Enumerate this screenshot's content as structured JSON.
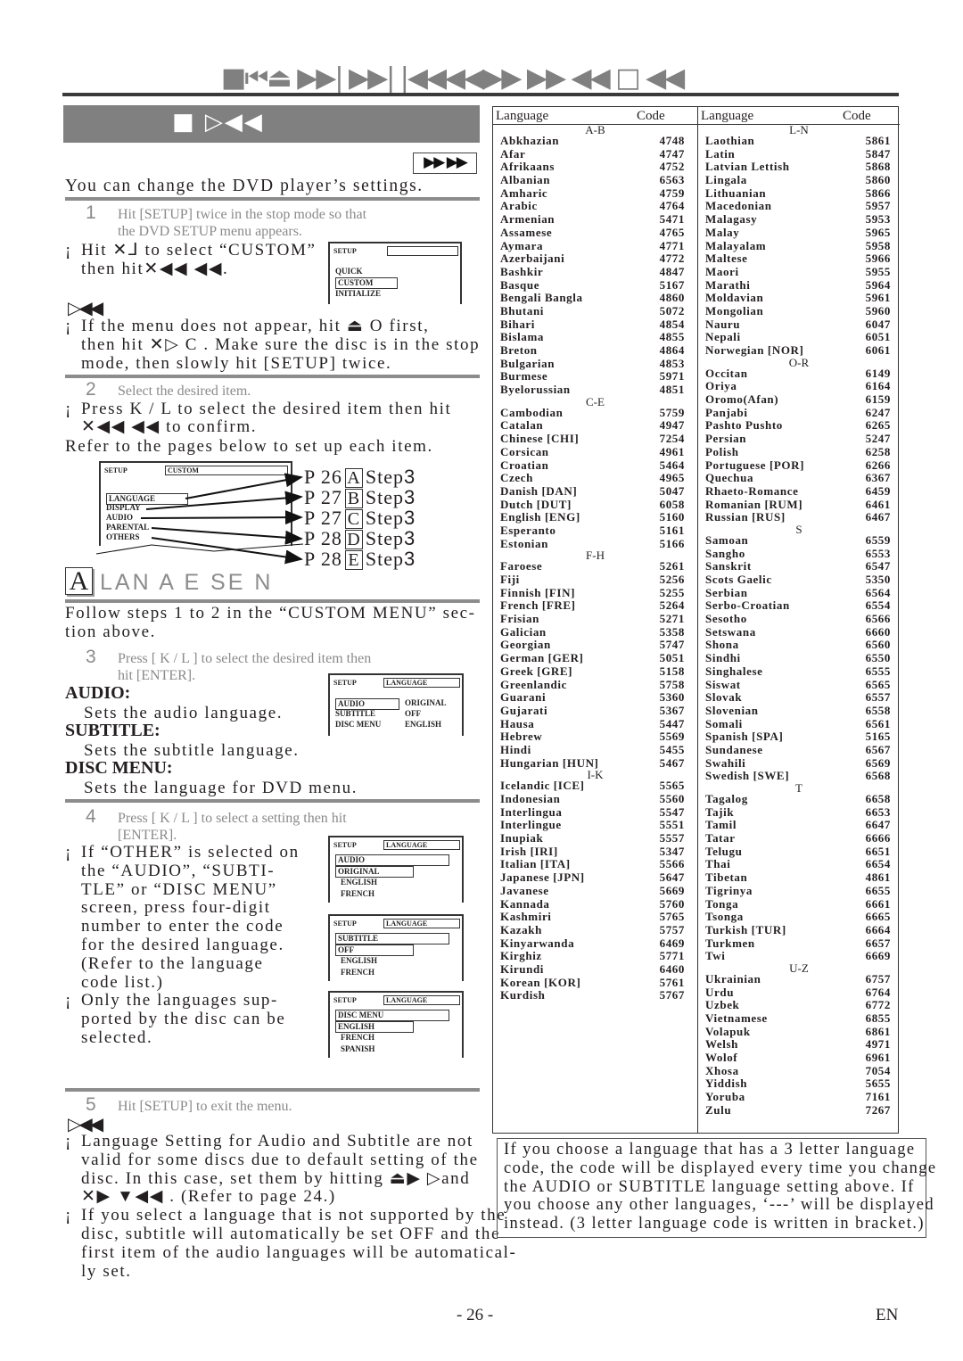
{
  "header": {
    "title_glyphs": "■⏮⏏ ▶▶| ▶▶| |◀◀◀◀▶▶ ▶▶ ◀◀ □ ◀◀",
    "section_banner_glyphs": "■  ▷◀◀",
    "badge_glyphs": "▶▶ ▶▶"
  },
  "intro": "You can change the DVD player’s settings.",
  "steps": {
    "s1": {
      "num": "1",
      "line1": "Hit [SETUP] twice in the stop mode so that",
      "line2": "the DVD SETUP menu appears."
    },
    "s1_bullet": {
      "line1": "Hit ✕⅃   to select “CUSTOM”",
      "line2": "then hit✕◀◀ ◀◀."
    },
    "note1_icon": "▷◀◀",
    "s1_note": {
      "line1": "If the menu does not appear, hit ⏏ O   first,",
      "line2": "then hit ✕▷   C . Make sure the disc is in the stop",
      "line3": "mode, then slowly hit [SETUP] twice."
    },
    "s2": {
      "num": "2",
      "text": "Select the desired item."
    },
    "s2_bullet": {
      "line1": "Press K / L   to select the desired item then hit",
      "line2": "✕◀◀ ◀◀ to confirm."
    },
    "s2_refer": "Refer to the pages below to set up each item.",
    "s3": {
      "num": "3",
      "line1": "Press [  K / L ] to select the desired item then",
      "line2": "hit [ENTER]."
    },
    "s4": {
      "num": "4",
      "line1": "Press [  K / L ] to select a setting then hit",
      "line2": "[ENTER]."
    },
    "s5": {
      "num": "5",
      "text": "Hit [SETUP] to exit the menu."
    }
  },
  "setup_osd_main": {
    "header": "SETUP",
    "items": [
      "QUICK",
      "CUSTOM",
      "INITIALIZE"
    ],
    "selected": "CUSTOM"
  },
  "custom_osd": {
    "header": "SETUP",
    "header_value": "CUSTOM",
    "items": [
      "LANGUAGE",
      "DISPLAY",
      "AUDIO",
      "PARENTAL",
      "OTHERS"
    ]
  },
  "page_refs": [
    {
      "page": "P 26",
      "letter": "A",
      "step": "Step",
      "step_num": "3"
    },
    {
      "page": "P 27",
      "letter": "B",
      "step": "Step",
      "step_num": "3"
    },
    {
      "page": "P 27",
      "letter": "C",
      "step": "Step",
      "step_num": "3"
    },
    {
      "page": "P 28",
      "letter": "D",
      "step": "Step",
      "step_num": "3"
    },
    {
      "page": "P 28",
      "letter": "E",
      "step": "Step",
      "step_num": "3"
    }
  ],
  "language_section": {
    "letter": "A",
    "title": "LAN  A  E SE N",
    "follow_line1": "Follow steps 1 to 2 in the “CUSTOM MENU” sec-",
    "follow_line2": "tion above.",
    "audio_label": "AUDIO:",
    "audio_desc": "Sets the audio language.",
    "subtitle_label": "SUBTITLE:",
    "subtitle_desc": "Sets the subtitle language.",
    "discmenu_label": "DISC MENU:",
    "discmenu_desc": "Sets the language for DVD menu."
  },
  "language_osd": {
    "header": "SETUP",
    "header_value": "LANGUAGE",
    "rows": [
      {
        "name": "AUDIO",
        "value": "ORIGINAL"
      },
      {
        "name": "SUBTITLE",
        "value": "OFF"
      },
      {
        "name": "DISC MENU",
        "value": "ENGLISH"
      }
    ]
  },
  "sub_osds": [
    {
      "header": "SETUP",
      "header_value": "LANGUAGE",
      "title": "AUDIO",
      "options": [
        "ORIGINAL",
        "ENGLISH",
        "FRENCH"
      ]
    },
    {
      "header": "SETUP",
      "header_value": "LANGUAGE",
      "title": "SUBTITLE",
      "options": [
        "OFF",
        "ENGLISH",
        "FRENCH"
      ]
    },
    {
      "header": "SETUP",
      "header_value": "LANGUAGE",
      "title": "DISC MENU",
      "options": [
        "ENGLISH",
        "FRENCH",
        "SPANISH"
      ]
    }
  ],
  "s4_bullets": {
    "other": [
      "If “OTHER” is selected on",
      "the “AUDIO”, “SUBTI-",
      "TLE” or “DISC MENU”",
      "screen, press four-digit",
      "number to enter the code",
      "for the desired language.",
      "(Refer to the language",
      "code list.)"
    ],
    "only": [
      "Only the languages sup-",
      "ported by the disc can be",
      "selected."
    ]
  },
  "final_notes": {
    "icon": "▷◀◀",
    "n1": [
      "Language Setting for Audio and Subtitle are not",
      "valid for some discs due to default setting of the",
      "disc. In this case, set them by hitting ⏏▶ ▷and",
      "✕▶  ▼◀◀  . (Refer to page 24.)"
    ],
    "n2": [
      "If you select a language that is not supported by the",
      "disc, subtitle will automatically be set OFF and the",
      "first item of the audio languages will be automatical-",
      "ly set."
    ]
  },
  "language_table": {
    "headers": {
      "language": "Language",
      "code": "Code"
    },
    "columns": [
      [
        {
          "group": "A-B"
        },
        {
          "name": "Abkhazian",
          "code": "4748"
        },
        {
          "name": "Afar",
          "code": "4747"
        },
        {
          "name": "Afrikaans",
          "code": "4752"
        },
        {
          "name": "Albanian",
          "code": "6563"
        },
        {
          "name": "Amharic",
          "code": "4759"
        },
        {
          "name": "Arabic",
          "code": "4764"
        },
        {
          "name": "Armenian",
          "code": "5471"
        },
        {
          "name": "Assamese",
          "code": "4765"
        },
        {
          "name": "Aymara",
          "code": "4771"
        },
        {
          "name": "Azerbaijani",
          "code": "4772"
        },
        {
          "name": "Bashkir",
          "code": "4847"
        },
        {
          "name": "Basque",
          "code": "5167"
        },
        {
          "name": "Bengali Bangla",
          "code": "4860"
        },
        {
          "name": "Bhutani",
          "code": "5072"
        },
        {
          "name": "Bihari",
          "code": "4854"
        },
        {
          "name": "Bislama",
          "code": "4855"
        },
        {
          "name": "Breton",
          "code": "4864"
        },
        {
          "name": "Bulgarian",
          "code": "4853"
        },
        {
          "name": "Burmese",
          "code": "5971"
        },
        {
          "name": "Byelorussian",
          "code": "4851"
        },
        {
          "group": "C-E"
        },
        {
          "name": "Cambodian",
          "code": "5759"
        },
        {
          "name": "Catalan",
          "code": "4947"
        },
        {
          "name": "Chinese [CHI]",
          "code": "7254"
        },
        {
          "name": "Corsican",
          "code": "4961"
        },
        {
          "name": "Croatian",
          "code": "5464"
        },
        {
          "name": "Czech",
          "code": "4965"
        },
        {
          "name": "Danish [DAN]",
          "code": "5047"
        },
        {
          "name": "Dutch [DUT]",
          "code": "6058"
        },
        {
          "name": "English [ENG]",
          "code": "5160"
        },
        {
          "name": "Esperanto",
          "code": "5161"
        },
        {
          "name": "Estonian",
          "code": "5166"
        },
        {
          "group": "F-H"
        },
        {
          "name": "Faroese",
          "code": "5261"
        },
        {
          "name": "Fiji",
          "code": "5256"
        },
        {
          "name": "Finnish [FIN]",
          "code": "5255"
        },
        {
          "name": "French [FRE]",
          "code": "5264"
        },
        {
          "name": "Frisian",
          "code": "5271"
        },
        {
          "name": "Galician",
          "code": "5358"
        },
        {
          "name": "Georgian",
          "code": "5747"
        },
        {
          "name": "German [GER]",
          "code": "5051"
        },
        {
          "name": "Greek [GRE]",
          "code": "5158"
        },
        {
          "name": "Greenlandic",
          "code": "5758"
        },
        {
          "name": "Guarani",
          "code": "5360"
        },
        {
          "name": "Gujarati",
          "code": "5367"
        },
        {
          "name": "Hausa",
          "code": "5447"
        },
        {
          "name": "Hebrew",
          "code": "5569"
        },
        {
          "name": "Hindi",
          "code": "5455"
        },
        {
          "name": "Hungarian [HUN]",
          "code": "5467"
        },
        {
          "group": "I-K"
        },
        {
          "name": "Icelandic [ICE]",
          "code": "5565"
        },
        {
          "name": "Indonesian",
          "code": "5560"
        },
        {
          "name": "Interlingua",
          "code": "5547"
        },
        {
          "name": "Interlingue",
          "code": "5551"
        },
        {
          "name": "Inupiak",
          "code": "5557"
        },
        {
          "name": "Irish [IRI]",
          "code": "5347"
        },
        {
          "name": "Italian [ITA]",
          "code": "5566"
        },
        {
          "name": "Japanese [JPN]",
          "code": "5647"
        },
        {
          "name": "Javanese",
          "code": "5669"
        },
        {
          "name": "Kannada",
          "code": "5760"
        },
        {
          "name": "Kashmiri",
          "code": "5765"
        },
        {
          "name": "Kazakh",
          "code": "5757"
        },
        {
          "name": "Kinyarwanda",
          "code": "6469"
        },
        {
          "name": "Kirghiz",
          "code": "5771"
        },
        {
          "name": "Kirundi",
          "code": "6460"
        },
        {
          "name": "Korean [KOR]",
          "code": "5761"
        },
        {
          "name": "Kurdish",
          "code": "5767"
        }
      ],
      [
        {
          "group": "L-N"
        },
        {
          "name": "Laothian",
          "code": "5861"
        },
        {
          "name": "Latin",
          "code": "5847"
        },
        {
          "name": "Latvian Lettish",
          "code": "5868"
        },
        {
          "name": "Lingala",
          "code": "5860"
        },
        {
          "name": "Lithuanian",
          "code": "5866"
        },
        {
          "name": "Macedonian",
          "code": "5957"
        },
        {
          "name": "Malagasy",
          "code": "5953"
        },
        {
          "name": "Malay",
          "code": "5965"
        },
        {
          "name": "Malayalam",
          "code": "5958"
        },
        {
          "name": "Maltese",
          "code": "5966"
        },
        {
          "name": "Maori",
          "code": "5955"
        },
        {
          "name": "Marathi",
          "code": "5964"
        },
        {
          "name": "Moldavian",
          "code": "5961"
        },
        {
          "name": "Mongolian",
          "code": "5960"
        },
        {
          "name": "Nauru",
          "code": "6047"
        },
        {
          "name": "Nepali",
          "code": "6051"
        },
        {
          "name": "Norwegian [NOR]",
          "code": "6061"
        },
        {
          "group": "O-R"
        },
        {
          "name": "Occitan",
          "code": "6149"
        },
        {
          "name": "Oriya",
          "code": "6164"
        },
        {
          "name": "Oromo(Afan)",
          "code": "6159"
        },
        {
          "name": "Panjabi",
          "code": "6247"
        },
        {
          "name": "Pashto Pushto",
          "code": "6265"
        },
        {
          "name": "Persian",
          "code": "5247"
        },
        {
          "name": "Polish",
          "code": "6258"
        },
        {
          "name": "Portuguese [POR]",
          "code": "6266"
        },
        {
          "name": "Quechua",
          "code": "6367"
        },
        {
          "name": "Rhaeto-Romance",
          "code": "6459"
        },
        {
          "name": "Romanian [RUM]",
          "code": "6461"
        },
        {
          "name": "Russian [RUS]",
          "code": "6467"
        },
        {
          "group": "S"
        },
        {
          "name": "Samoan",
          "code": "6559"
        },
        {
          "name": "Sangho",
          "code": "6553"
        },
        {
          "name": "Sanskrit",
          "code": "6547"
        },
        {
          "name": "Scots Gaelic",
          "code": "5350"
        },
        {
          "name": "Serbian",
          "code": "6564"
        },
        {
          "name": "Serbo-Croatian",
          "code": "6554"
        },
        {
          "name": "Sesotho",
          "code": "6566"
        },
        {
          "name": "Setswana",
          "code": "6660"
        },
        {
          "name": "Shona",
          "code": "6560"
        },
        {
          "name": "Sindhi",
          "code": "6550"
        },
        {
          "name": "Singhalese",
          "code": "6555"
        },
        {
          "name": "Siswat",
          "code": "6565"
        },
        {
          "name": "Slovak",
          "code": "6557"
        },
        {
          "name": "Slovenian",
          "code": "6558"
        },
        {
          "name": "Somali",
          "code": "6561"
        },
        {
          "name": "Spanish [SPA]",
          "code": "5165"
        },
        {
          "name": "Sundanese",
          "code": "6567"
        },
        {
          "name": "Swahili",
          "code": "6569"
        },
        {
          "name": "Swedish [SWE]",
          "code": "6568"
        },
        {
          "group": "T"
        },
        {
          "name": "Tagalog",
          "code": "6658"
        },
        {
          "name": "Tajik",
          "code": "6653"
        },
        {
          "name": "Tamil",
          "code": "6647"
        },
        {
          "name": "Tatar",
          "code": "6666"
        },
        {
          "name": "Telugu",
          "code": "6651"
        },
        {
          "name": "Thai",
          "code": "6654"
        },
        {
          "name": "Tibetan",
          "code": "4861"
        },
        {
          "name": "Tigrinya",
          "code": "6655"
        },
        {
          "name": "Tonga",
          "code": "6661"
        },
        {
          "name": "Tsonga",
          "code": "6665"
        },
        {
          "name": "Turkish [TUR]",
          "code": "6664"
        },
        {
          "name": "Turkmen",
          "code": "6657"
        },
        {
          "name": "Twi",
          "code": "6669"
        },
        {
          "group": "U-Z"
        },
        {
          "name": "Ukrainian",
          "code": "6757"
        },
        {
          "name": "Urdu",
          "code": "6764"
        },
        {
          "name": "Uzbek",
          "code": "6772"
        },
        {
          "name": "Vietnamese",
          "code": "6855"
        },
        {
          "name": "Volapuk",
          "code": "6861"
        },
        {
          "name": "Welsh",
          "code": "4971"
        },
        {
          "name": "Wolof",
          "code": "6961"
        },
        {
          "name": "Xhosa",
          "code": "7054"
        },
        {
          "name": "Yiddish",
          "code": "5655"
        },
        {
          "name": "Yoruba",
          "code": "7161"
        },
        {
          "name": "Zulu",
          "code": "7267"
        }
      ]
    ]
  },
  "note_box": [
    "If you choose a language that has a 3 letter language",
    "code, the code will be displayed every time you change",
    "the AUDIO or SUBTITLE language setting above. If",
    "you choose any other languages, ‘---’ will be displayed",
    "instead. (3 letter language code is written in bracket.)"
  ],
  "footer": {
    "page_number": "- 26 -",
    "language": "EN"
  }
}
